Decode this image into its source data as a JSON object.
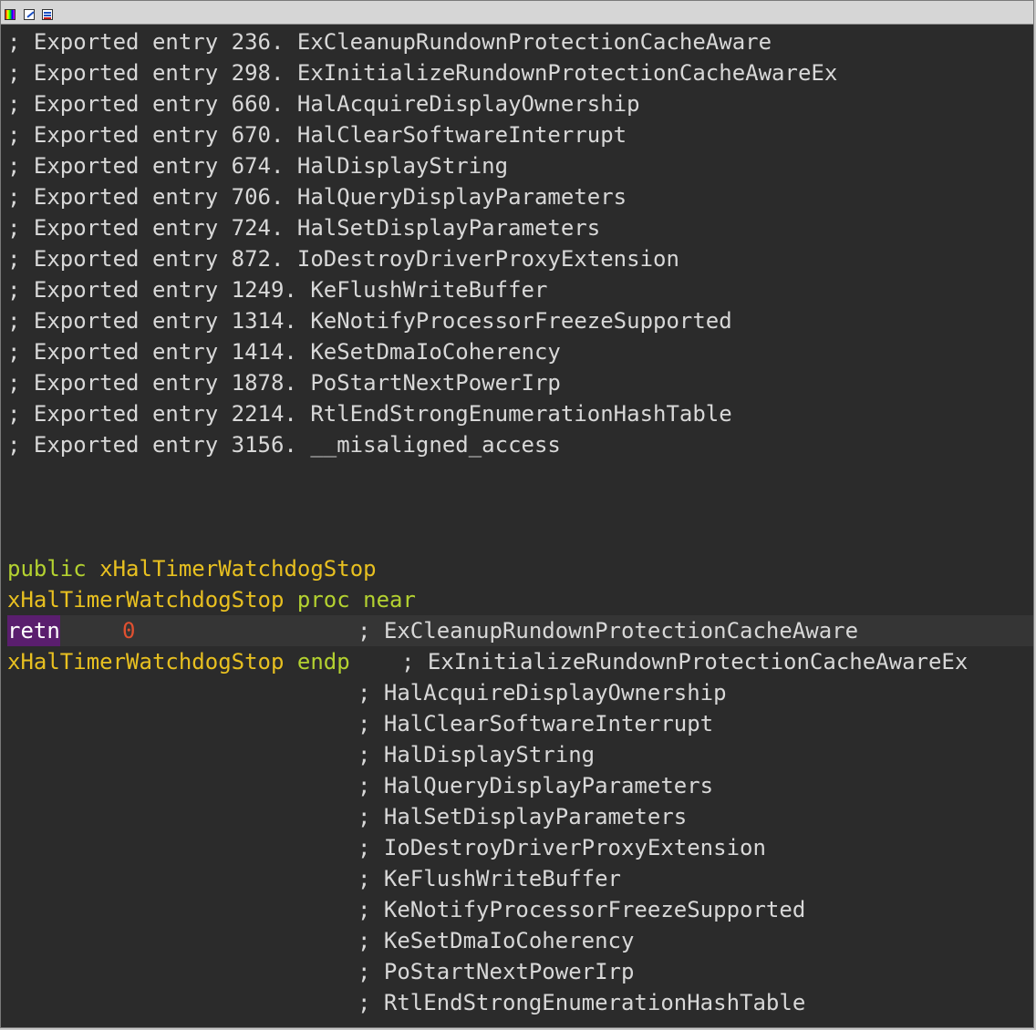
{
  "toolbar": {
    "icons": [
      "colors-icon",
      "edit-icon",
      "graph-icon"
    ]
  },
  "colors": {
    "background": "#2b2b2b",
    "comment": "#d8d8d8",
    "keyword": "#b4d230",
    "name": "#e8c020",
    "number": "#e05030",
    "highlight": "#5a1e6e"
  },
  "header_comments": [
    "; Exported entry 236. ExCleanupRundownProtectionCacheAware",
    "; Exported entry 298. ExInitializeRundownProtectionCacheAwareEx",
    "; Exported entry 660. HalAcquireDisplayOwnership",
    "; Exported entry 670. HalClearSoftwareInterrupt",
    "; Exported entry 674. HalDisplayString",
    "; Exported entry 706. HalQueryDisplayParameters",
    "; Exported entry 724. HalSetDisplayParameters",
    "; Exported entry 872. IoDestroyDriverProxyExtension",
    "; Exported entry 1249. KeFlushWriteBuffer",
    "; Exported entry 1314. KeNotifyProcessorFreezeSupported",
    "; Exported entry 1414. KeSetDmaIoCoherency",
    "; Exported entry 1878. PoStartNextPowerIrp",
    "; Exported entry 2214. RtlEndStrongEnumerationHashTable",
    "; Exported entry 3156. __misaligned_access"
  ],
  "public_line": {
    "keyword": "public",
    "name": "xHalTimerWatchdogStop"
  },
  "proc_line": {
    "name": "xHalTimerWatchdogStop",
    "keyword": "proc near"
  },
  "retn_line": {
    "mnemonic": "retn",
    "operand": "0",
    "comment": "; ExCleanupRundownProtectionCacheAware"
  },
  "endp_line": {
    "name": "xHalTimerWatchdogStop",
    "keyword": "endp",
    "comment": "; ExInitializeRundownProtectionCacheAwareEx"
  },
  "trailing_comments": [
    "; HalAcquireDisplayOwnership",
    "; HalClearSoftwareInterrupt",
    "; HalDisplayString",
    "; HalQueryDisplayParameters",
    "; HalSetDisplayParameters",
    "; IoDestroyDriverProxyExtension",
    "; KeFlushWriteBuffer",
    "; KeNotifyProcessorFreezeSupported",
    "; KeSetDmaIoCoherency",
    "; PoStartNextPowerIrp",
    "; RtlEndStrongEnumerationHashTable"
  ]
}
